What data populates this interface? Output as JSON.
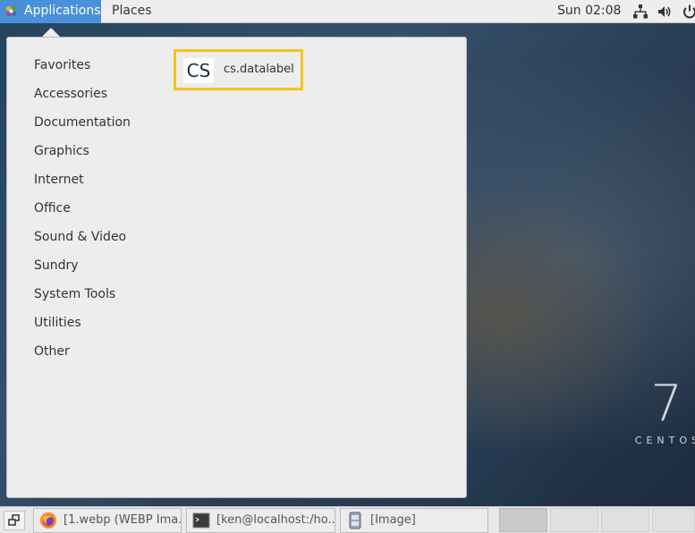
{
  "topbar": {
    "applications_label": "Applications",
    "places_label": "Places",
    "clock": "Sun 02:08"
  },
  "menu": {
    "categories": [
      "Favorites",
      "Accessories",
      "Documentation",
      "Graphics",
      "Internet",
      "Office",
      "Sound & Video",
      "Sundry",
      "System Tools",
      "Utilities",
      "Other"
    ],
    "app": {
      "icon_text": "CS",
      "label": "cs.datalabel"
    }
  },
  "desktop": {
    "logo_numeral": "7",
    "logo_word": "CENTOS"
  },
  "taskbar": {
    "tasks": [
      "[1.webp (WEBP Ima...",
      "[ken@localhost:/ho...",
      "[Image]"
    ]
  },
  "colors": {
    "accent": "#4a90d9",
    "highlight": "#f5c518"
  }
}
